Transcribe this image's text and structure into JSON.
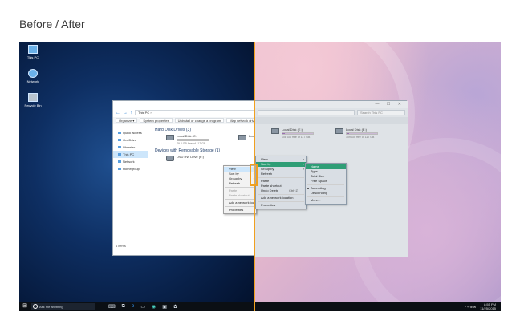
{
  "page": {
    "title": "Before / After"
  },
  "compare": {
    "divider_color": "#f0a020"
  },
  "desktop": {
    "icons": [
      {
        "label": "This PC"
      },
      {
        "label": "Network"
      },
      {
        "label": "Recycle Bin"
      }
    ]
  },
  "explorer": {
    "title_controls": "— ☐ ✕",
    "nav_back": "←",
    "nav_forward": "→",
    "nav_up": "↑",
    "address": "This PC ›",
    "search_placeholder": "Search This PC",
    "ribbon": [
      "Organize ▾",
      "System properties",
      "Uninstall or change a program",
      "Map network drive",
      "Open Control Panel"
    ],
    "nav_items": [
      {
        "label": "Quick access"
      },
      {
        "label": "OneDrive"
      },
      {
        "label": "Libraries"
      },
      {
        "label": "This PC"
      },
      {
        "label": "Network"
      },
      {
        "label": "Homegroup"
      }
    ],
    "groups": {
      "hard_disk": "Hard Disk Drives (3)",
      "removable": "Devices with Removable Storage (1)"
    },
    "drives": [
      {
        "name": "Local Disk (C:)",
        "free": "79.2 GB free of 117 GB",
        "fill": 0.32
      },
      {
        "name": "Local Disk (D:)",
        "free": ""
      },
      {
        "name": "Local Disk (E:)",
        "free": "108 GB free of 117 GB",
        "fill": 0.08
      },
      {
        "name": "Local Disk (E:)",
        "free": "109 GB free of 117 GB",
        "fill": 0.07
      }
    ],
    "dvd": {
      "name": "DVD RW Drive (F:)"
    },
    "status": "4 items"
  },
  "context_before": {
    "items": [
      {
        "label": "View",
        "arrow": "›",
        "hl": true
      },
      {
        "label": "Sort by",
        "arrow": "›"
      },
      {
        "label": "Group by",
        "arrow": "›"
      },
      {
        "label": "Refresh"
      },
      {
        "label": "Paste"
      },
      {
        "label": "Paste shortcut"
      },
      {
        "label": "Add a network location"
      },
      {
        "label": "Properties"
      }
    ]
  },
  "context_after_main": {
    "items": [
      {
        "label": "View",
        "arrow": "›"
      },
      {
        "label": "Sort by",
        "arrow": "›",
        "hl": true
      },
      {
        "label": "Group by",
        "arrow": "›"
      },
      {
        "label": "Refresh"
      },
      {
        "label": "Paste"
      },
      {
        "label": "Paste shortcut"
      },
      {
        "label": "Undo Delete",
        "kb": "Ctrl+Z"
      },
      {
        "label": "Add a network location"
      },
      {
        "label": "Properties"
      }
    ]
  },
  "context_after_sub": {
    "items": [
      {
        "label": "Name",
        "hl": true
      },
      {
        "label": "Type"
      },
      {
        "label": "Total Size"
      },
      {
        "label": "Free Space"
      },
      {
        "label": "Ascending",
        "chk": true
      },
      {
        "label": "Descending"
      },
      {
        "label": "More..."
      }
    ]
  },
  "taskbar": {
    "start": "⊞",
    "search_text": "Ask me anything",
    "icons": [
      "⌨",
      "⧉",
      "e",
      "▭",
      "◉",
      "▣",
      "✿"
    ],
    "tray": "^ ⌁ ⊕ ✉",
    "time": "8:55 PM",
    "date": "11/25/2015"
  }
}
